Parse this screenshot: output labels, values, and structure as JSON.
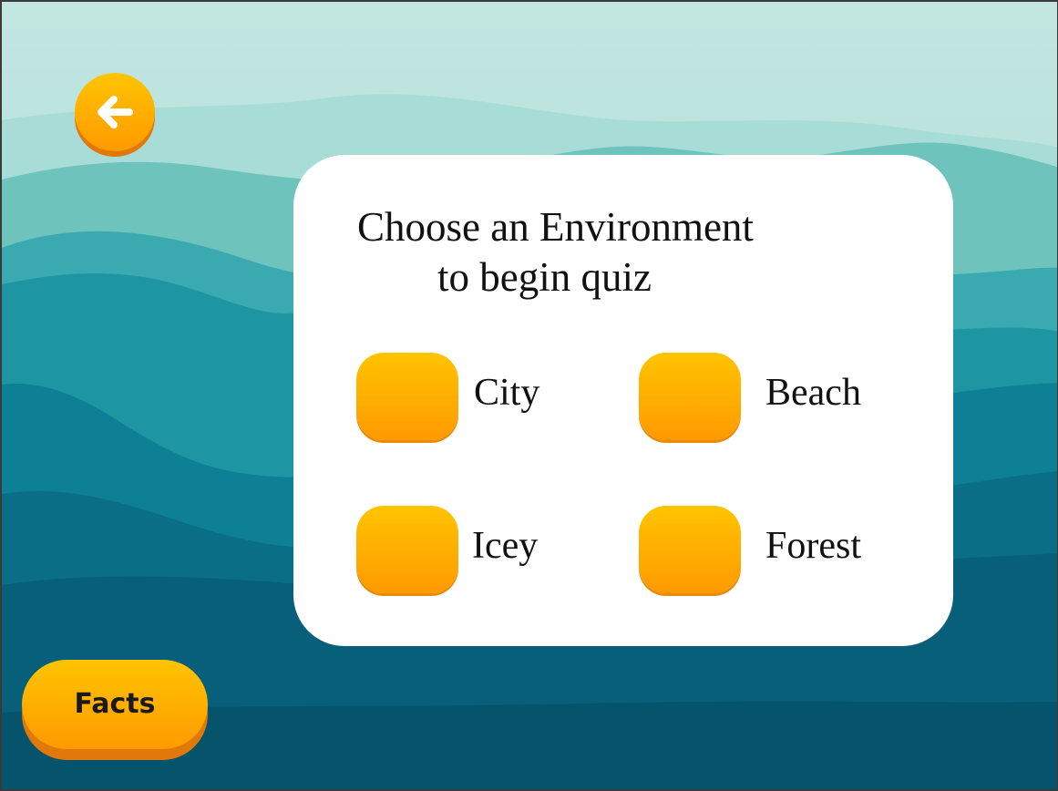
{
  "theme": {
    "button_gradient_top": "#ffc400",
    "button_gradient_bottom": "#ff9a00",
    "button_shadow": "#e0780a",
    "card_background": "#ffffff"
  },
  "back_button": {
    "icon": "arrow-left-icon"
  },
  "card": {
    "title_line1": "Choose an Environment",
    "title_line2": "to begin quiz"
  },
  "environments": [
    {
      "label": "City"
    },
    {
      "label": "Beach"
    },
    {
      "label": "Icey"
    },
    {
      "label": "Forest"
    }
  ],
  "facts_button": {
    "label": "Facts"
  }
}
